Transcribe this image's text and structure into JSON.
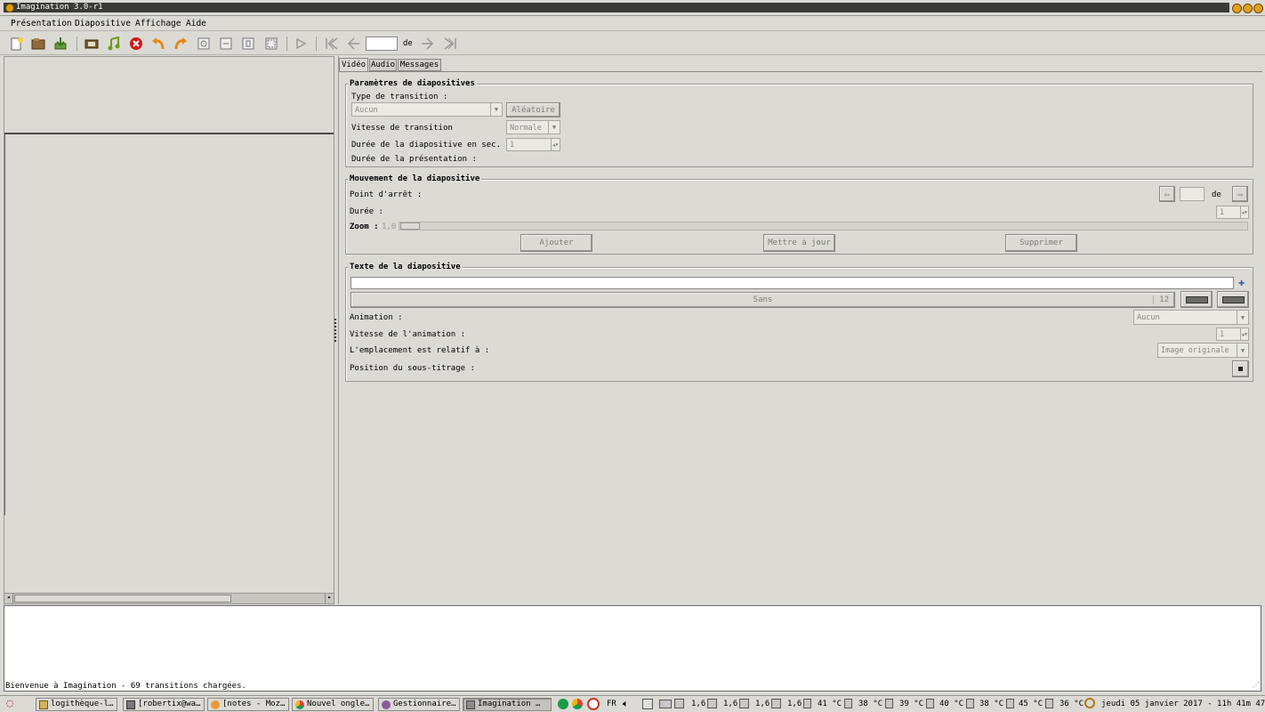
{
  "window": {
    "title": "Imagination 3.0-r1"
  },
  "menu": [
    "Présentation",
    "Diapositive",
    "Affichage",
    "Aide"
  ],
  "toolbar": {
    "icons": [
      "new-icon",
      "open-icon",
      "save-icon",
      "import-pictures-icon",
      "import-music-icon",
      "delete-icon",
      "rotate-left-icon",
      "rotate-right-icon",
      "zoom-in-icon",
      "zoom-normal-icon",
      "zoom-out-icon",
      "zoom-fit-icon",
      "preview-icon",
      "first-slide-icon",
      "previous-slide-icon",
      "next-slide-icon",
      "last-slide-icon"
    ],
    "slide_number": "",
    "of_label": "de"
  },
  "tabs": [
    "Vidéo",
    "Audio",
    "Messages"
  ],
  "slide_params": {
    "title": "Paramètres de diapositives",
    "transition_type_label": "Type de transition :",
    "transition_type_value": "Aucun",
    "random_button": "Aléatoire",
    "transition_speed_label": "Vitesse de transition",
    "transition_speed_value": "Normale",
    "slide_duration_label": "Durée de la diapositive en sec. :",
    "slide_duration_value": "1",
    "presentation_duration_label": "Durée de la présentation :"
  },
  "slide_motion": {
    "title": "Mouvement de la diapositive",
    "stop_point_label": "Point d'arrêt :",
    "of_label": "de",
    "duration_label": "Durée :",
    "duration_value": "1",
    "zoom_label": "Zoom :",
    "zoom_value": "1,0",
    "add_button": "Ajouter",
    "update_button": "Mettre à jour",
    "remove_button": "Supprimer"
  },
  "slide_text": {
    "title": "Texte de la diapositive",
    "text_value": "",
    "font_name": "Sans",
    "font_size": "12",
    "animation_label": "Animation :",
    "animation_value": "Aucun",
    "animation_speed_label": "Vitesse de l'animation :",
    "animation_speed_value": "1",
    "placement_label": "L'emplacement est relatif à :",
    "placement_value": "Image originale",
    "subtitle_position_label": "Position du sous-titrage :"
  },
  "statusbar": {
    "text": "Bienvenue à Imagination - 69 transitions chargées."
  },
  "taskbar": {
    "tasks": [
      "logithèque-l…",
      "[robertix@wa…",
      "[notes - Moz…",
      "Nouvel ongle…",
      "Gestionnaire…",
      "Imagination …"
    ],
    "lang": "FR",
    "cpu": [
      "1,6",
      "1,6",
      "1,6",
      "1,6"
    ],
    "temps": [
      "41 °C",
      "38 °C",
      "39 °C",
      "40 °C",
      "38 °C",
      "45 °C",
      "36 °C"
    ],
    "clock": "jeudi 05 janvier 2017 - 11h 41m 47s"
  },
  "colors": {
    "background": "#dcdad5",
    "accent_orange": "#e4a01a",
    "delete_red": "#d01818"
  }
}
